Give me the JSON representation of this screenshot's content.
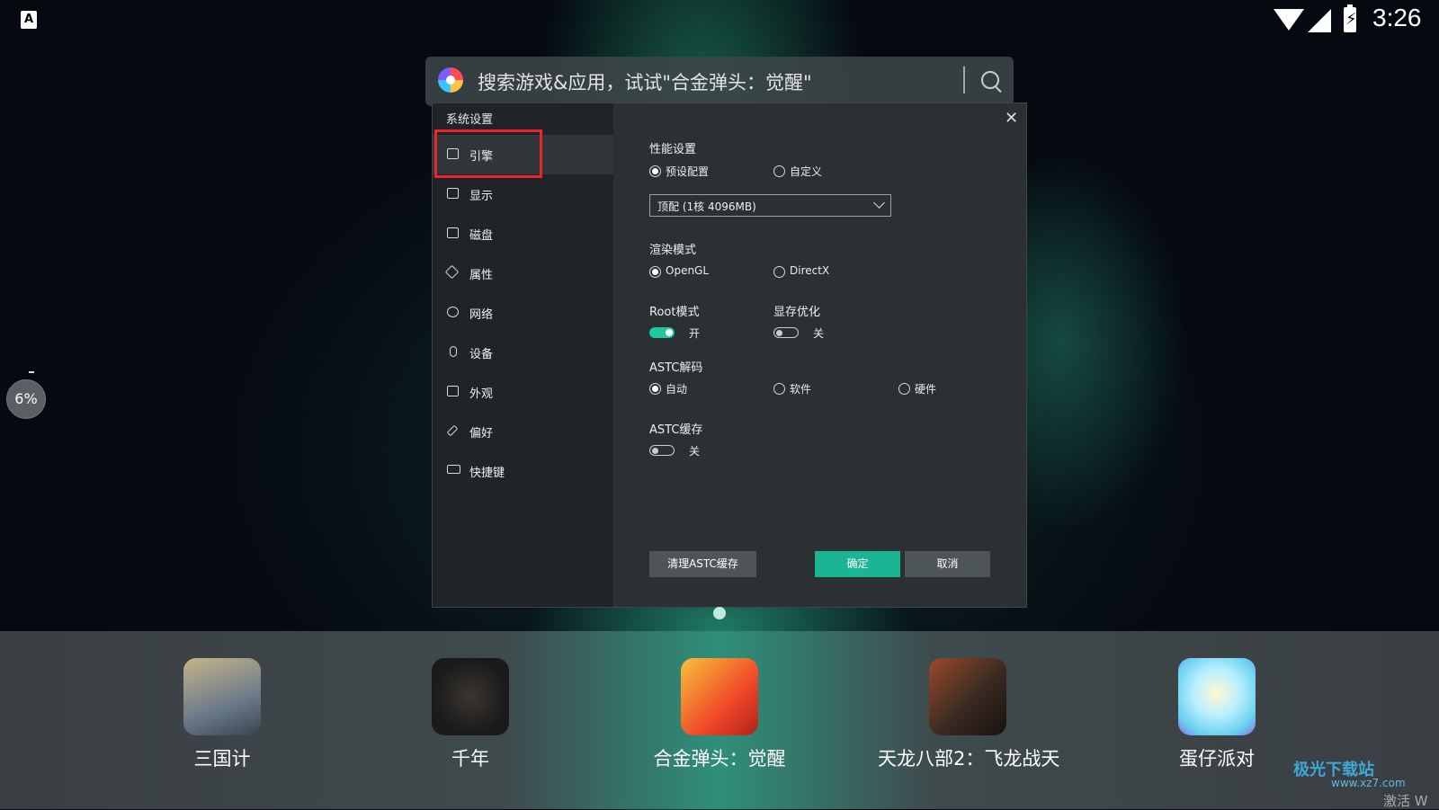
{
  "status_bar": {
    "time": "3:26",
    "notification": "A"
  },
  "search": {
    "placeholder": "搜索游戏&应用，试试\"合金弹头：觉醒\""
  },
  "floating_badge": {
    "percent": "6%"
  },
  "dialog": {
    "title": "系统设置",
    "sidebar": [
      {
        "label": "引擎",
        "icon": "chip-icon",
        "active": true
      },
      {
        "label": "显示",
        "icon": "monitor-icon"
      },
      {
        "label": "磁盘",
        "icon": "disk-icon"
      },
      {
        "label": "属性",
        "icon": "tag-icon"
      },
      {
        "label": "网络",
        "icon": "globe-icon"
      },
      {
        "label": "设备",
        "icon": "microphone-icon"
      },
      {
        "label": "外观",
        "icon": "window-icon"
      },
      {
        "label": "偏好",
        "icon": "wrench-icon"
      },
      {
        "label": "快捷键",
        "icon": "keyboard-icon"
      }
    ],
    "performance": {
      "title": "性能设置",
      "options": [
        "预设配置",
        "自定义"
      ],
      "selected": "预设配置",
      "preset_value": "顶配 (1核 4096MB)"
    },
    "render": {
      "title": "渲染模式",
      "options": [
        "OpenGL",
        "DirectX"
      ],
      "selected": "OpenGL"
    },
    "root": {
      "title": "Root模式",
      "state": "开",
      "on": true
    },
    "vram": {
      "title": "显存优化",
      "state": "关",
      "on": false
    },
    "astc_decode": {
      "title": "ASTC解码",
      "options": [
        "自动",
        "软件",
        "硬件"
      ],
      "selected": "自动"
    },
    "astc_cache": {
      "title": "ASTC缓存",
      "state": "关",
      "on": false
    },
    "buttons": {
      "clear_cache": "清理ASTC缓存",
      "ok": "确定",
      "cancel": "取消"
    }
  },
  "dock_apps": [
    {
      "name": "三国计",
      "colors": [
        "#6b7a8a",
        "#c7b48a"
      ]
    },
    {
      "name": "千年",
      "colors": [
        "#1a1a1a",
        "#3a3530"
      ]
    },
    {
      "name": "合金弹头：觉醒",
      "colors": [
        "#f04a2a",
        "#f7c23a"
      ]
    },
    {
      "name": "天龙八部2：飞龙战天",
      "colors": [
        "#3a2a22",
        "#9a4a2a"
      ]
    },
    {
      "name": "蛋仔派对",
      "colors": [
        "#6ad0f0",
        "#b9f0ff"
      ]
    }
  ],
  "watermark": {
    "text": "极光下载站",
    "url": "www.xz7.com"
  },
  "activate_text": "激活 W"
}
